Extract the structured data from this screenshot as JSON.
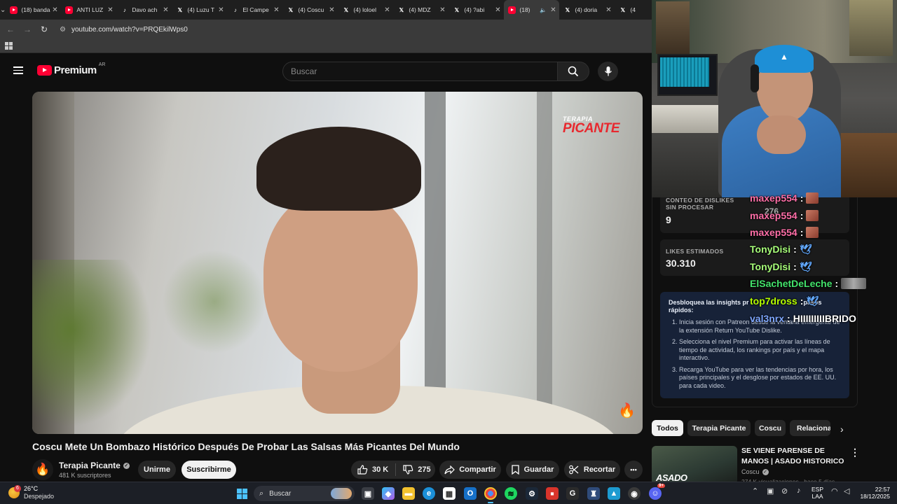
{
  "browser": {
    "tabs": [
      {
        "label": "(18) banda",
        "favicon": "youtube-icon"
      },
      {
        "label": "ANTI LUZ",
        "favicon": "youtube-icon"
      },
      {
        "label": "Davo ach",
        "favicon": "tiktok-icon"
      },
      {
        "label": "(4) Luzu T",
        "favicon": "x-icon"
      },
      {
        "label": "El Campe",
        "favicon": "tiktok-icon"
      },
      {
        "label": "(4) Coscu",
        "favicon": "x-icon"
      },
      {
        "label": "(4) loloel",
        "favicon": "x-icon"
      },
      {
        "label": "(4) MDZ",
        "favicon": "x-icon"
      },
      {
        "label": "(4) ?abi",
        "favicon": "x-icon"
      },
      {
        "label": "(18) ",
        "favicon": "youtube-icon",
        "active": true
      },
      {
        "label": "(4) doria",
        "favicon": "x-icon"
      },
      {
        "label": "(4",
        "favicon": "x-icon"
      }
    ],
    "url": "youtube.com/watch?v=PRQEkilWps0"
  },
  "youtube": {
    "logo_text": "Premium",
    "country": "AR",
    "search_placeholder": "Buscar",
    "video": {
      "watermark_top": "TERAPIA",
      "watermark_bottom": "PICANTE",
      "title": "Coscu Mete Un Bombazo Histórico Después De Probar Las Salsas Más Picantes Del Mundo",
      "channel": "Terapia Picante",
      "subscribers": "481 K suscriptores",
      "join_label": "Unirme",
      "subscribe_label": "Suscribirme",
      "likes": "30 K",
      "dislikes": "275",
      "share_label": "Compartir",
      "save_label": "Guardar",
      "clip_label": "Recortar",
      "more_label": "•••"
    },
    "dislike_panel": {
      "raw_label": "CONTEO DE DISLIKES SIN PROCESAR",
      "raw_value": "9",
      "partial_hidden_value": "276",
      "estimated_label": "LIKES ESTIMADOS",
      "estimated_value": "30.310",
      "insights_head": "Desbloquea las insights pr... pasos rápidos:",
      "insights_head_left": "Desbloquea las insights pr",
      "insights_head_right": "pasos",
      "insights_head_line2": "rápidos:",
      "steps": [
        "Inicia sesión con Patreon desde la ventana emergente de la extensión Return YouTube Dislike.",
        "Selecciona el nivel Premium para activar las líneas de tiempo de actividad, los rankings por país y el mapa interactivo.",
        "Recarga YouTube para ver las tendencias por hora, los países principales y el desglose por estados de EE. UU. para cada video."
      ]
    },
    "chips": [
      "Todos",
      "Terapia Picante",
      "Coscu",
      "Relacionado"
    ],
    "recommended": {
      "thumb_text": "ASADO",
      "title": "SE VIENE PARENSE DE MANOS | ASADO HISTORICO",
      "channel": "Coscu",
      "meta": "274 K visualizaciones · hace 5 días"
    }
  },
  "chat": [
    {
      "user": "maxep554",
      "color": "#ff6fa8",
      "emote": "face"
    },
    {
      "user": "maxep554",
      "color": "#ff6fa8",
      "emote": "face"
    },
    {
      "user": "maxep554",
      "color": "#ff6fa8",
      "emote": "face"
    },
    {
      "user": "TonyDisi",
      "color": "#a8ff7a",
      "emote": "bird"
    },
    {
      "user": "TonyDisi",
      "color": "#a8ff7a",
      "emote": "bird"
    },
    {
      "user": "ElSachetDeLeche",
      "color": "#43e36b",
      "emote": "pic"
    },
    {
      "user": "top7dross",
      "color": "#b6ff00",
      "emote": "bird"
    },
    {
      "user": "val3nrx",
      "color": "#7ea7ff",
      "text": "HIIIIIIIIIBRIDO"
    }
  ],
  "chat_sep": ":",
  "taskbar": {
    "weather_temp": "26°C",
    "weather_desc": "Despejado",
    "weather_badge": "6",
    "search_label": "Buscar",
    "lang_line1": "ESP",
    "lang_line2": "LAA",
    "time": "22:57",
    "date": "18/12/2025",
    "discord_badge": "9+"
  },
  "colors": {
    "accent": "#ff0033",
    "insight_bg": "#172238",
    "windows_accent": "#4cc2ff"
  }
}
